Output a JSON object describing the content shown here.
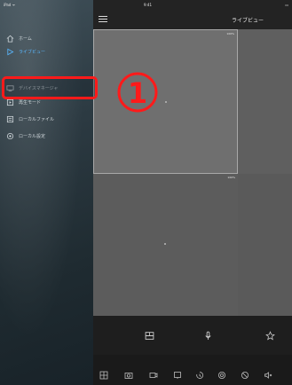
{
  "status": {
    "carrier": "iPad ᯤ",
    "time": "9:41",
    "battery": "▭"
  },
  "sidebar": {
    "items": [
      {
        "label": "ホーム",
        "icon": "home-icon",
        "active": false
      },
      {
        "label": "ライブビュー",
        "icon": "play-icon",
        "active": true
      },
      {
        "label": "",
        "icon": "",
        "active": false
      },
      {
        "label": "デバイスマネージャ",
        "icon": "device-manager-icon",
        "active": false
      },
      {
        "label": "再生モード",
        "icon": "playback-icon",
        "active": false
      },
      {
        "label": "ローカルファイル",
        "icon": "local-file-icon",
        "active": false
      },
      {
        "label": "ローカル設定",
        "icon": "settings-icon",
        "active": false
      }
    ]
  },
  "header": {
    "title": "ライブビュー",
    "menu_icon": "menu-icon"
  },
  "views": [
    {
      "pct": "100%"
    },
    {
      "pct": ""
    },
    {
      "pct": "100%"
    },
    {
      "pct": ""
    }
  ],
  "controls": [
    "layout-icon",
    "microphone-icon",
    "favorite-icon"
  ],
  "toolbar": [
    "split-screen-icon",
    "snapshot-icon",
    "record-icon",
    "ptz-icon",
    "playback-icon",
    "zoom-icon",
    "stop-icon",
    "sound-icon"
  ],
  "annotation": {
    "number": "①",
    "color": "#ff1a1a"
  }
}
